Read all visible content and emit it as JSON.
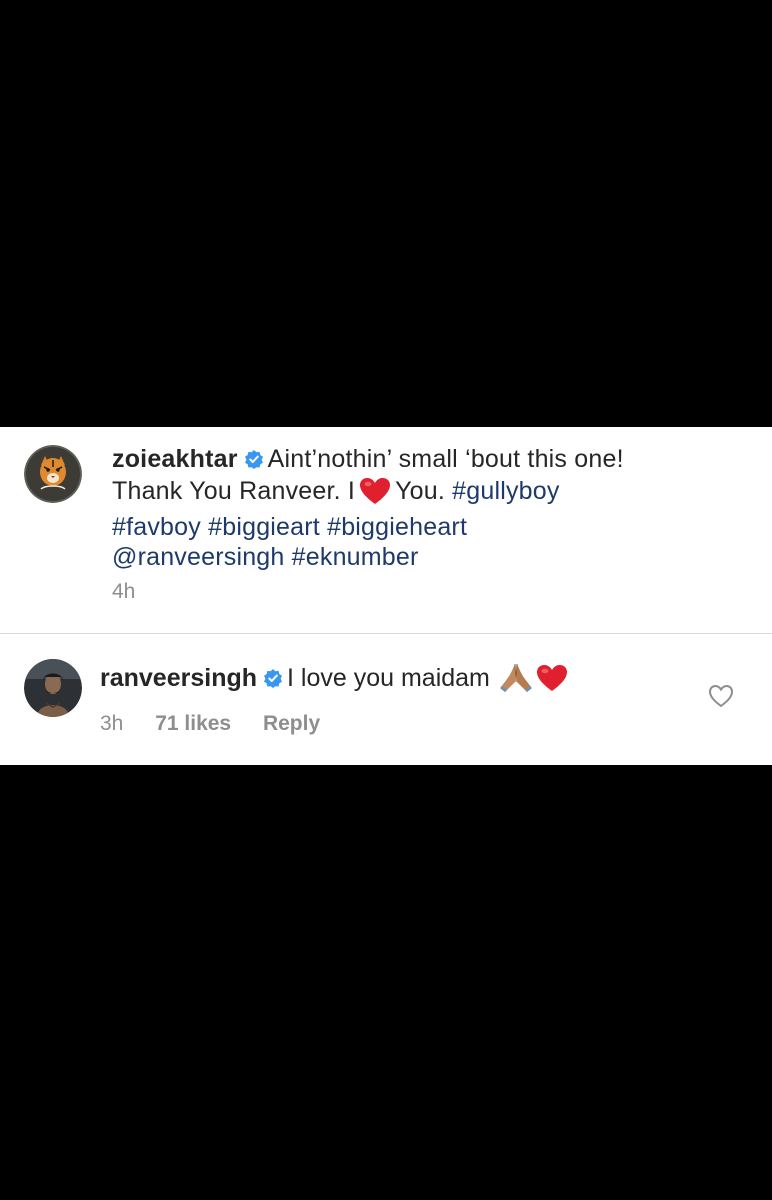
{
  "post_caption": {
    "username": "zoieakhtar",
    "text_part1": "Aint’nothin’ small ‘bout this one!",
    "text_part2": "Thank You Ranveer. I",
    "text_part3": "You.",
    "hashtags": [
      "#gullyboy",
      "#favboy",
      "#biggieart",
      "#biggieheart"
    ],
    "mention": "@ranveersingh",
    "last_hashtag": "#eknumber",
    "time": "4h"
  },
  "reply_comment": {
    "username": "ranveersingh",
    "text": "I love you maidam",
    "time": "3h",
    "likes": "71 likes",
    "reply_label": "Reply"
  },
  "colors": {
    "link": "#1e3a6b",
    "verified": "#3897f0",
    "secondary_text": "#8e8e8e",
    "heart_emoji": "#e0202e"
  },
  "icons": {
    "verified": "verified-badge-icon",
    "heart_emoji": "red-heart-emoji-icon",
    "pray_emoji": "folded-hands-emoji-icon",
    "like": "heart-outline-icon"
  }
}
